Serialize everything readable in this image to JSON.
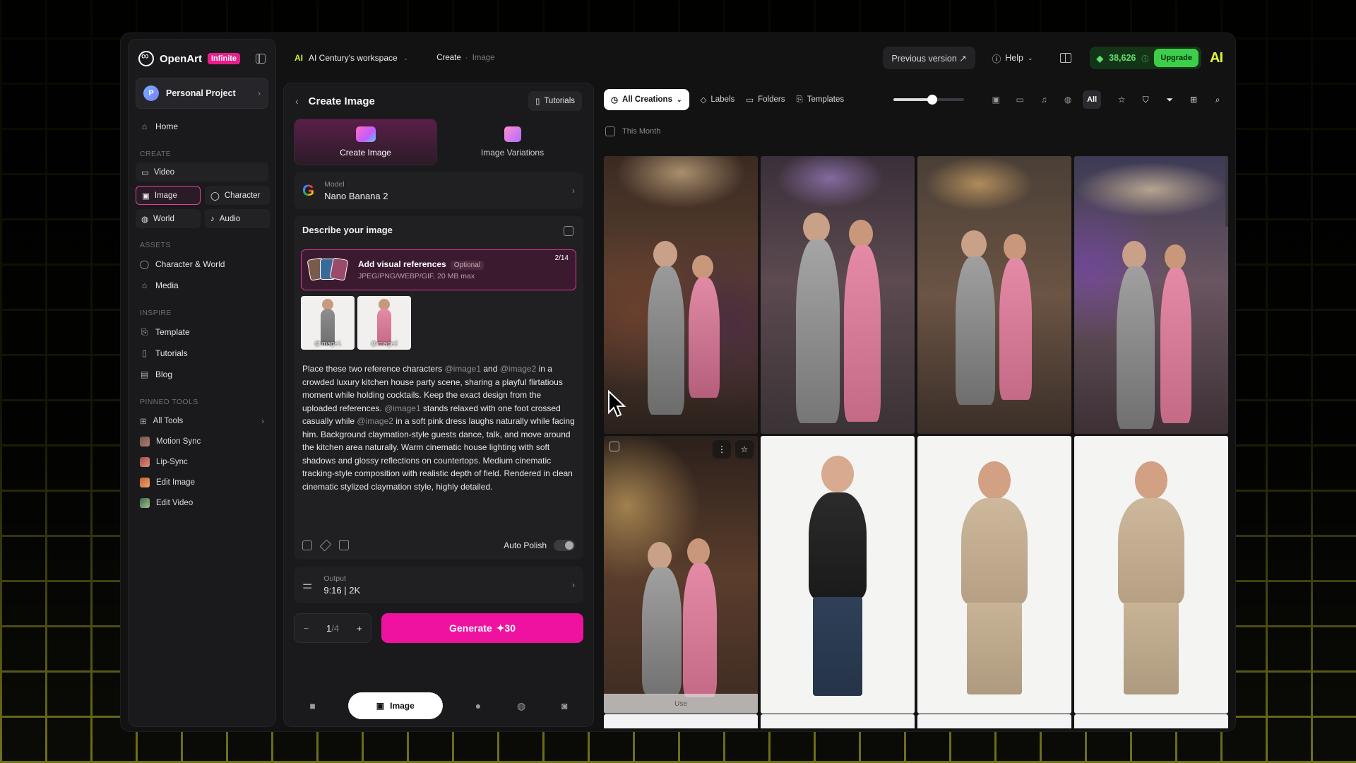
{
  "brand": {
    "name": "OpenArt",
    "plan_badge": "Infinite"
  },
  "project": {
    "avatar_letter": "P",
    "label": "Personal Project"
  },
  "sidebar": {
    "home": "Home",
    "create_section": "CREATE",
    "create_items": [
      {
        "label": "Video",
        "icon": "video-icon"
      },
      {
        "label": "Image",
        "icon": "image-icon"
      },
      {
        "label": "Character",
        "icon": "character-icon"
      },
      {
        "label": "World",
        "icon": "world-icon"
      },
      {
        "label": "Audio",
        "icon": "audio-icon"
      }
    ],
    "assets_section": "ASSETS",
    "assets_items": [
      "Character & World",
      "Media"
    ],
    "inspire_section": "INSPIRE",
    "inspire_items": [
      "Template",
      "Tutorials",
      "Blog"
    ],
    "pinned_section": "PINNED TOOLS",
    "pinned_items": [
      "All Tools",
      "Motion Sync",
      "Lip-Sync",
      "Edit Image",
      "Edit Video"
    ]
  },
  "header": {
    "workspace_icon": "AI",
    "workspace": "AI Century's workspace",
    "crumb_1": "Create",
    "crumb_2": "Image",
    "previous_version": "Previous version ↗",
    "help": "Help",
    "credits": "38,626",
    "upgrade": "Upgrade",
    "logo": "AI"
  },
  "panel": {
    "title": "Create Image",
    "tutorials": "Tutorials",
    "tabs": [
      "Create Image",
      "Image Variations"
    ],
    "model_label": "Model",
    "model_value": "Nano Banana 2",
    "describe_title": "Describe your image",
    "refs_title": "Add visual references",
    "refs_optional": "Optional",
    "refs_formats": "JPEG/PNG/WEBP/GIF, 20 MB max",
    "refs_count": "2/14",
    "ref_tags": [
      "@image1",
      "@image2"
    ],
    "prompt_parts": {
      "p1": "Place these two reference characters",
      "ref1": "@image1",
      "p2": "and",
      "ref2": "@image2",
      "p3": "in a crowded luxury kitchen house party scene, sharing a playful flirtatious moment while holding cocktails. Keep the exact design from the uploaded references.",
      "ref3": "@image1",
      "p4": "stands relaxed with one foot crossed casually while",
      "ref4": "@image2",
      "p5": "in a soft pink dress laughs naturally while facing him. Background claymation-style guests dance, talk, and move around the kitchen area naturally. Warm cinematic house lighting with soft shadows and glossy reflections on countertops. Medium cinematic tracking-style composition with realistic depth of field. Rendered in clean cinematic stylized claymation style, highly detailed."
    },
    "auto_polish": "Auto Polish",
    "output_label": "Output",
    "output_value": "9:16 | 2K",
    "count_current": "1",
    "count_total": "/4",
    "generate_label": "Generate",
    "generate_cost": "✦30",
    "bottom_active": "Image"
  },
  "gallery": {
    "all_creations": "All Creations",
    "labels": "Labels",
    "folders": "Folders",
    "templates": "Templates",
    "size_slider": 0.55,
    "filter_all": "All",
    "section_month": "This Month",
    "use_label": "Use"
  },
  "colors": {
    "accent_pink": "#ef12a0",
    "credits_green": "#3ccf4a",
    "logo_yellow": "#e5f53b"
  }
}
